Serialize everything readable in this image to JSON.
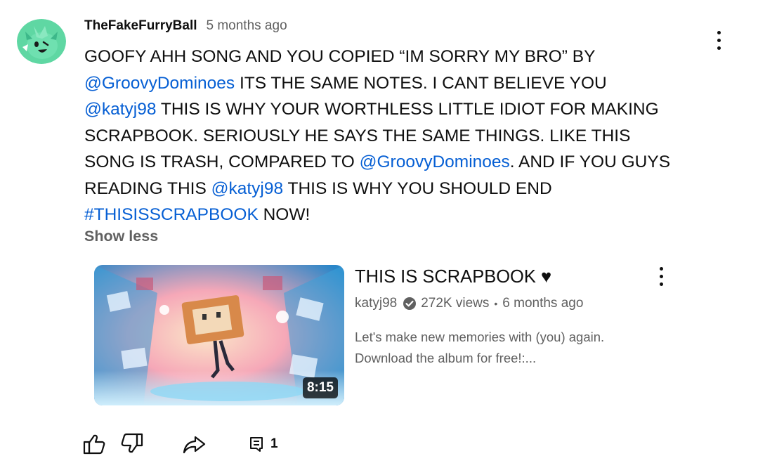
{
  "comment": {
    "author": "TheFakeFurryBall",
    "time": "5 months ago",
    "lines": [
      [
        {
          "t": "GOOFY AHH SONG AND YOU COPIED “IM SORRY MY BRO” BY"
        }
      ],
      [
        {
          "t": "@GroovyDominoes",
          "m": true
        },
        {
          "t": "  ITS THE SAME NOTES. I CANT BELIEVE YOU"
        }
      ],
      [
        {
          "t": "@katyj98",
          "m": true
        },
        {
          "t": "  THIS IS WHY YOUR WORTHLESS LITTLE IDIOT FOR MAKING"
        }
      ],
      [
        {
          "t": "SCRAPBOOK. SERIOUSLY HE SAYS THE SAME THINGS. LIKE THIS"
        }
      ],
      [
        {
          "t": "SONG IS TRASH, COMPARED TO "
        },
        {
          "t": "@GroovyDominoes",
          "m": true
        },
        {
          "t": ". AND IF YOU GUYS"
        }
      ],
      [
        {
          "t": "READING THIS "
        },
        {
          "t": "@katyj98",
          "m": true
        },
        {
          "t": "  THIS IS WHY YOU SHOULD END"
        }
      ],
      [
        {
          "t": "#THISISSCRAPBOOK",
          "m": true
        },
        {
          "t": " NOW!"
        }
      ]
    ],
    "show_less": "Show less"
  },
  "video": {
    "title": "THIS IS SCRAPBOOK ♥",
    "channel": "katyj98",
    "views": "272K views",
    "age": "6 months ago",
    "separator": "•",
    "description_lines": [
      "Let's make new memories with (you) again.",
      "Download the album for free!:..."
    ],
    "duration": "8:15"
  },
  "actions": {
    "reply_count": "1",
    "icons": [
      "thumbs-up-icon",
      "thumbs-down-icon",
      "share-icon",
      "replies-icon"
    ]
  },
  "colors": {
    "link": "#065fd4",
    "secondary_text": "#606060",
    "primary_text": "#0f0f0f",
    "avatar_bg": "#5fd7a3"
  }
}
